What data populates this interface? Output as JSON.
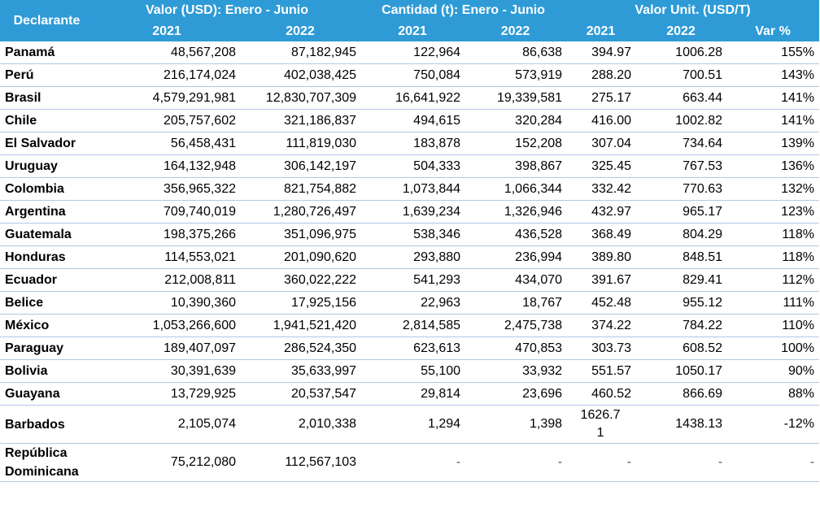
{
  "header": {
    "declarante": "Declarante",
    "group_valor": "Valor (USD): Enero - Junio",
    "group_cantidad": "Cantidad (t): Enero - Junio",
    "group_unit": "Valor Unit. (USD/T)",
    "y2021_a": "2021",
    "y2022_a": "2022",
    "y2021_b": "2021",
    "y2022_b": "2022",
    "y2021_c": "2021",
    "y2022_c": "2022",
    "var": "Var %"
  },
  "rows": [
    {
      "pais": "Panamá",
      "v2021": "48,567,208",
      "v2022": "87,182,945",
      "c2021": "122,964",
      "c2022": "86,638",
      "u2021": "394.97",
      "u2022": "1006.28",
      "var": "155%"
    },
    {
      "pais": "Perú",
      "v2021": "216,174,024",
      "v2022": "402,038,425",
      "c2021": "750,084",
      "c2022": "573,919",
      "u2021": "288.20",
      "u2022": "700.51",
      "var": "143%"
    },
    {
      "pais": "Brasil",
      "v2021": "4,579,291,981",
      "v2022": "12,830,707,309",
      "c2021": "16,641,922",
      "c2022": "19,339,581",
      "u2021": "275.17",
      "u2022": "663.44",
      "var": "141%"
    },
    {
      "pais": "Chile",
      "v2021": "205,757,602",
      "v2022": "321,186,837",
      "c2021": "494,615",
      "c2022": "320,284",
      "u2021": "416.00",
      "u2022": "1002.82",
      "var": "141%"
    },
    {
      "pais": "El Salvador",
      "v2021": "56,458,431",
      "v2022": "111,819,030",
      "c2021": "183,878",
      "c2022": "152,208",
      "u2021": "307.04",
      "u2022": "734.64",
      "var": "139%"
    },
    {
      "pais": "Uruguay",
      "v2021": "164,132,948",
      "v2022": "306,142,197",
      "c2021": "504,333",
      "c2022": "398,867",
      "u2021": "325.45",
      "u2022": "767.53",
      "var": "136%"
    },
    {
      "pais": "Colombia",
      "v2021": "356,965,322",
      "v2022": "821,754,882",
      "c2021": "1,073,844",
      "c2022": "1,066,344",
      "u2021": "332.42",
      "u2022": "770.63",
      "var": "132%"
    },
    {
      "pais": "Argentina",
      "v2021": "709,740,019",
      "v2022": "1,280,726,497",
      "c2021": "1,639,234",
      "c2022": "1,326,946",
      "u2021": "432.97",
      "u2022": "965.17",
      "var": "123%"
    },
    {
      "pais": "Guatemala",
      "v2021": "198,375,266",
      "v2022": "351,096,975",
      "c2021": "538,346",
      "c2022": "436,528",
      "u2021": "368.49",
      "u2022": "804.29",
      "var": "118%"
    },
    {
      "pais": "Honduras",
      "v2021": "114,553,021",
      "v2022": "201,090,620",
      "c2021": "293,880",
      "c2022": "236,994",
      "u2021": "389.80",
      "u2022": "848.51",
      "var": "118%"
    },
    {
      "pais": "Ecuador",
      "v2021": "212,008,811",
      "v2022": "360,022,222",
      "c2021": "541,293",
      "c2022": "434,070",
      "u2021": "391.67",
      "u2022": "829.41",
      "var": "112%"
    },
    {
      "pais": "Belice",
      "v2021": "10,390,360",
      "v2022": "17,925,156",
      "c2021": "22,963",
      "c2022": "18,767",
      "u2021": "452.48",
      "u2022": "955.12",
      "var": "111%"
    },
    {
      "pais": "México",
      "v2021": "1,053,266,600",
      "v2022": "1,941,521,420",
      "c2021": "2,814,585",
      "c2022": "2,475,738",
      "u2021": "374.22",
      "u2022": "784.22",
      "var": "110%"
    },
    {
      "pais": "Paraguay",
      "v2021": "189,407,097",
      "v2022": "286,524,350",
      "c2021": "623,613",
      "c2022": "470,853",
      "u2021": "303.73",
      "u2022": "608.52",
      "var": "100%"
    },
    {
      "pais": "Bolivia",
      "v2021": "30,391,639",
      "v2022": "35,633,997",
      "c2021": "55,100",
      "c2022": "33,932",
      "u2021": "551.57",
      "u2022": "1050.17",
      "var": "90%"
    },
    {
      "pais": "Guayana",
      "v2021": "13,729,925",
      "v2022": "20,537,547",
      "c2021": "29,814",
      "c2022": "23,696",
      "u2021": "460.52",
      "u2022": "866.69",
      "var": "88%"
    },
    {
      "pais": "Barbados",
      "v2021": "2,105,074",
      "v2022": "2,010,338",
      "c2021": "1,294",
      "c2022": "1,398",
      "u2021": "1626.71",
      "u2022": "1438.13",
      "var": "-12%"
    },
    {
      "pais": "República Dominicana",
      "v2021": "75,212,080",
      "v2022": "112,567,103",
      "c2021": "-",
      "c2022": "-",
      "u2021": "-",
      "u2022": "-",
      "var": "-"
    }
  ]
}
